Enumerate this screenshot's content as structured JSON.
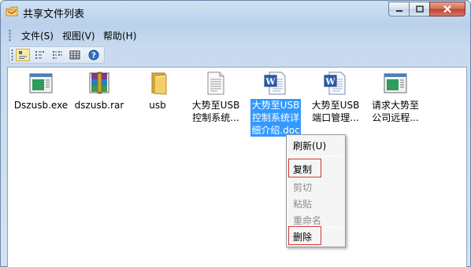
{
  "window": {
    "title": "共享文件列表"
  },
  "menubar": {
    "items": [
      "文件(S)",
      "视图(V)",
      "帮助(H)"
    ]
  },
  "toolbar": {
    "buttons": [
      "large-icons",
      "small-icons",
      "list-view",
      "details-view",
      "help"
    ]
  },
  "files": [
    {
      "name": "Dszusb.exe",
      "icon": "exe-icon"
    },
    {
      "name": "dszusb.rar",
      "icon": "rar-icon"
    },
    {
      "name": "usb",
      "icon": "folder-icon"
    },
    {
      "name": "大势至USB\n控制系统...",
      "icon": "text-file-icon"
    },
    {
      "name": "大势至USB\n控制系统详\n细介绍.doc",
      "icon": "word-doc-icon",
      "selected": true
    },
    {
      "name": "大势至USB\n端口管理...",
      "icon": "word-doc-icon"
    },
    {
      "name": "请求大势至\n公司远程...",
      "icon": "exe-icon"
    }
  ],
  "context_menu": {
    "refresh": "刷新(U)",
    "copy": "复制",
    "cut": "剪切",
    "paste": "粘贴",
    "rename": "重命名",
    "delete": "删除"
  },
  "colors": {
    "selection": "#3399ff",
    "highlight_box": "#d23a3a"
  }
}
